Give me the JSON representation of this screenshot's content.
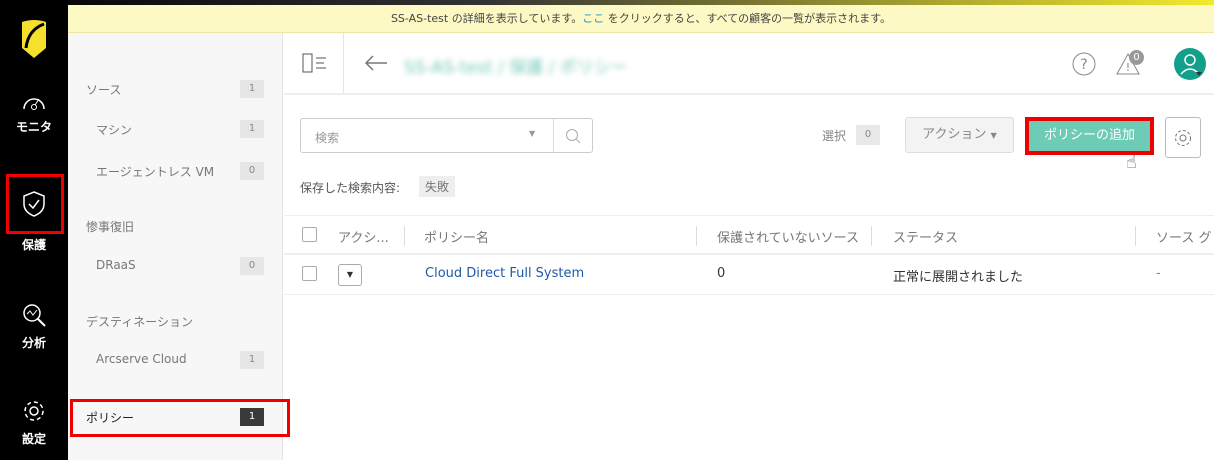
{
  "banner": {
    "text_before": "SS-AS-test の詳細を表示しています。",
    "link": "ここ",
    "text_after": " をクリックすると、すべての顧客の一覧が表示されます。"
  },
  "nav": [
    {
      "label": "モニタ",
      "icon": "gauge-icon"
    },
    {
      "label": "保護",
      "icon": "shield-check-icon",
      "active": true
    },
    {
      "label": "分析",
      "icon": "analysis-icon"
    },
    {
      "label": "設定",
      "icon": "gear-icon"
    }
  ],
  "sidebar": {
    "items": [
      {
        "label": "ソース",
        "count": "1"
      },
      {
        "label": "マシン",
        "count": "1"
      },
      {
        "label": "エージェントレス VM",
        "count": "0"
      },
      {
        "label": "惨事復旧"
      },
      {
        "label": "DRaaS",
        "count": "0"
      },
      {
        "label": "デスティネーション"
      },
      {
        "label": "Arcserve Cloud",
        "count": "1"
      },
      {
        "label": "ポリシー",
        "count": "1"
      }
    ]
  },
  "header": {
    "breadcrumb": "SS-AS-test / 保護 / ポリシー",
    "alerts_count": "0"
  },
  "toolbar": {
    "search_placeholder": "検索",
    "selected_label": "選択",
    "selected_count": "0",
    "actions_label": "アクション",
    "add_policy_label": "ポリシーの追加",
    "saved_search_label": "保存した検索内容:",
    "saved_search_tag": "失敗"
  },
  "table": {
    "columns": [
      "アクシ...",
      "ポリシー名",
      "保護されていないソース",
      "ステータス",
      "ソース グ"
    ],
    "rows": [
      {
        "name": "Cloud Direct Full System",
        "unprotected": "0",
        "status": "正常に展開されました",
        "source_group": "-"
      }
    ]
  },
  "colors": {
    "accent": "#6dcbb6",
    "highlight": "#e00000",
    "logo": "#f5e12c"
  }
}
